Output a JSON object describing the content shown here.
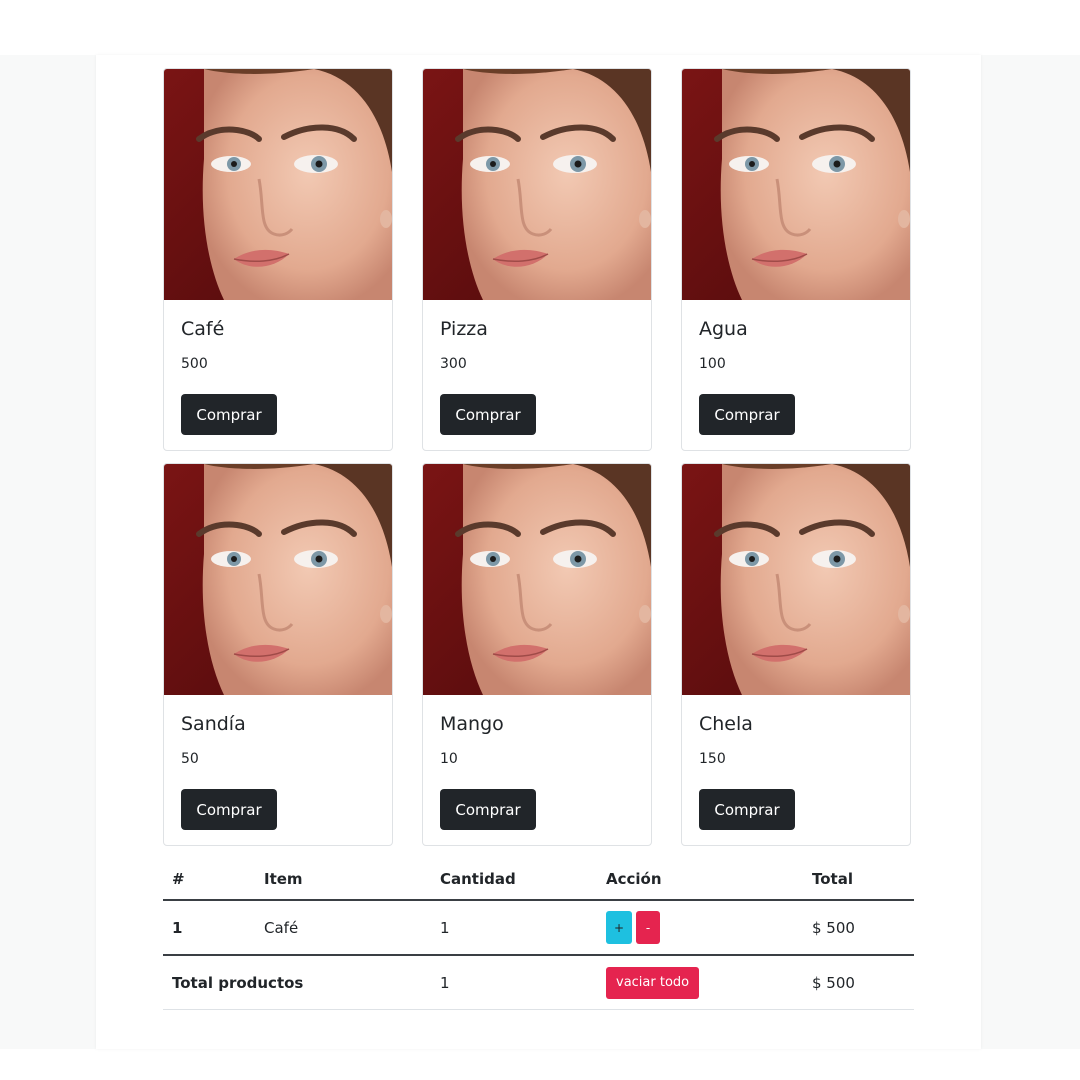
{
  "products": [
    {
      "name": "Café",
      "price": "500",
      "button": "Comprar"
    },
    {
      "name": "Pizza",
      "price": "300",
      "button": "Comprar"
    },
    {
      "name": "Agua",
      "price": "100",
      "button": "Comprar"
    },
    {
      "name": "Sandía",
      "price": "50",
      "button": "Comprar"
    },
    {
      "name": "Mango",
      "price": "10",
      "button": "Comprar"
    },
    {
      "name": "Chela",
      "price": "150",
      "button": "Comprar"
    }
  ],
  "cart": {
    "headers": [
      "#",
      "Item",
      "Cantidad",
      "Acción",
      "Total"
    ],
    "rows": [
      {
        "index": "1",
        "item": "Café",
        "quantity": "1",
        "plus": "+",
        "minus": "-",
        "total": "$ 500"
      }
    ],
    "footer": {
      "label": "Total productos",
      "quantity": "1",
      "empty_button": "vaciar todo",
      "total": "$ 500"
    }
  },
  "colors": {
    "buy_button": "#212529",
    "plus_button": "#1ec0e0",
    "danger_button": "#e5244f",
    "photo_background": "#6b0f10"
  }
}
